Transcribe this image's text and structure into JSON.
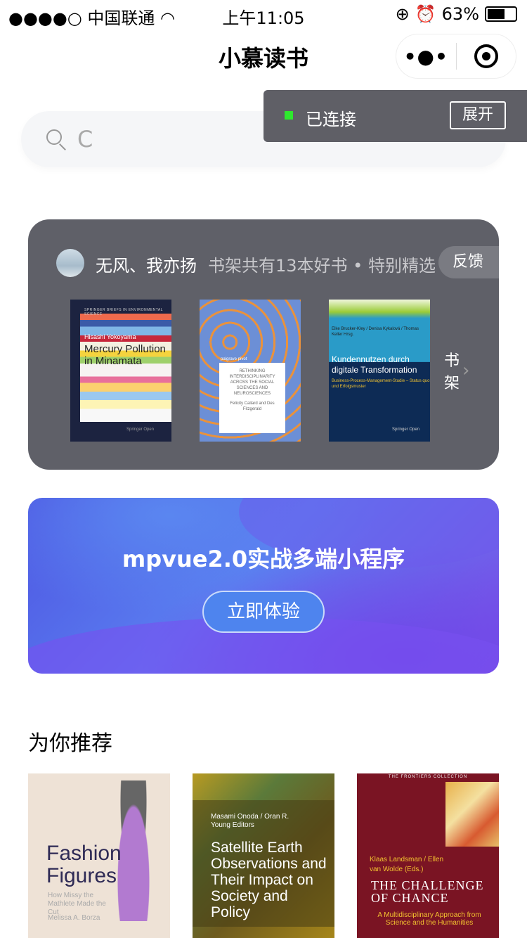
{
  "status_bar": {
    "signal": "●●●●○",
    "carrier": "中国联通",
    "time": "上午11:05",
    "battery": "63%",
    "battery_level": 0.63,
    "icons": [
      "wifi-icon",
      "rotation-lock-icon",
      "alarm-icon",
      "battery-icon"
    ]
  },
  "nav": {
    "title": "小慕读书",
    "more": "•●•"
  },
  "toast": {
    "status": "已连接",
    "status_color": "#2ee82e",
    "button": "展开"
  },
  "search": {
    "value": "C",
    "placeholder": ""
  },
  "shelf_card": {
    "username": "无风、我亦扬",
    "info": "书架共有13本好书 • 特别精选",
    "feedback": "反馈",
    "shelf_link": "书架",
    "books": [
      {
        "series": "SPRINGER BRIEFS IN ENVIRONMENTAL SCIENCE",
        "author": "Hisashi Yokoyama",
        "title": "Mercury Pollution in Minamata",
        "publisher": "Springer Open"
      },
      {
        "imprint": "palgrave pivot",
        "title": "RETHINKING INTERDISCIPLINARITY ACROSS THE SOCIAL SCIENCES AND NEUROSCIENCES",
        "author": "Felicity Callard and Des Fitzgerald"
      },
      {
        "authors": "Elke Brucker-Kley / Denisa Kykalová / Thomas Keller Hrsg.",
        "title": "Kundennutzen durch digitale Transformation",
        "subtitle": "Business-Process-Management-Studie – Status quo und Erfolgsmuster",
        "publisher": "Springer Open"
      }
    ]
  },
  "banner": {
    "title": "mpvue2.0实战多端小程序",
    "button": "立即体验"
  },
  "recommend": {
    "title": "为你推荐",
    "books": [
      {
        "title": "Fashion Figures",
        "subtitle": "How Missy the Mathlete Made the Cut",
        "author": "Melissa A. Borza"
      },
      {
        "authors": "Masami Onoda / Oran R. Young Editors",
        "title": "Satellite Earth Observations and Their Impact on Society and Policy"
      },
      {
        "series": "THE FRONTIERS COLLECTION",
        "authors": "Klaas Landsman / Ellen van Wolde (Eds.)",
        "title": "THE CHALLENGE OF CHANCE",
        "subtitle": "A Multidisciplinary Approach from Science and the Humanities"
      }
    ]
  }
}
